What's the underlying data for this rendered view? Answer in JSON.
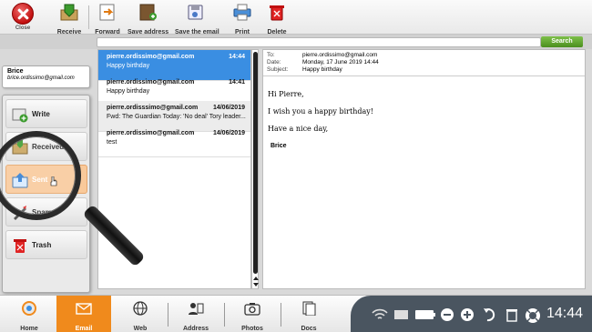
{
  "toolbar": {
    "close": "Close",
    "receive": "Receive",
    "forward": "Forward",
    "save_address": "Save address",
    "save_email": "Save the email",
    "print": "Print",
    "delete": "Delete"
  },
  "search": {
    "button": "Search",
    "value": ""
  },
  "account": {
    "name": "Brice",
    "email": "brice.ordissimo@gmail.com"
  },
  "folders": [
    {
      "label": "Write"
    },
    {
      "label": "Received"
    },
    {
      "label": "Sent"
    },
    {
      "label": "Spam"
    },
    {
      "label": "Trash"
    }
  ],
  "messages": [
    {
      "from": "pierre.ordissimo@gmail.com",
      "date": "14:44",
      "subject": "Happy birthday"
    },
    {
      "from": "pierre.ordissimo@gmail.com",
      "date": "14:41",
      "subject": "Happy birthday"
    },
    {
      "from": "pierre.ordisssimo@gmail.com",
      "date": "14/06/2019",
      "subject": "Fwd: The Guardian Today: 'No deal' Tory leader..."
    },
    {
      "from": "pierre.ordissimo@gmail.com",
      "date": "14/06/2019",
      "subject": "test"
    }
  ],
  "email": {
    "to_label": "To:",
    "to": "pierre.ordissimo@gmail.com",
    "date_label": "Date:",
    "date": "Monday, 17 June 2019 14:44",
    "subject_label": "Subject:",
    "subject": "Happy birthday",
    "greeting": "Hi Pierre,",
    "line1": "I wish you a happy birthday!",
    "line2": "Have a nice day,",
    "signature": "Brice"
  },
  "taskbar": {
    "home": "Home",
    "email": "Email",
    "web": "Web",
    "address": "Address",
    "photos": "Photos",
    "docs": "Docs",
    "clock": "14:44"
  },
  "colors": {
    "accent": "#f08a1c",
    "selection": "#3a8ee2",
    "search": "#4b8f1e",
    "tray": "#4a5560"
  }
}
